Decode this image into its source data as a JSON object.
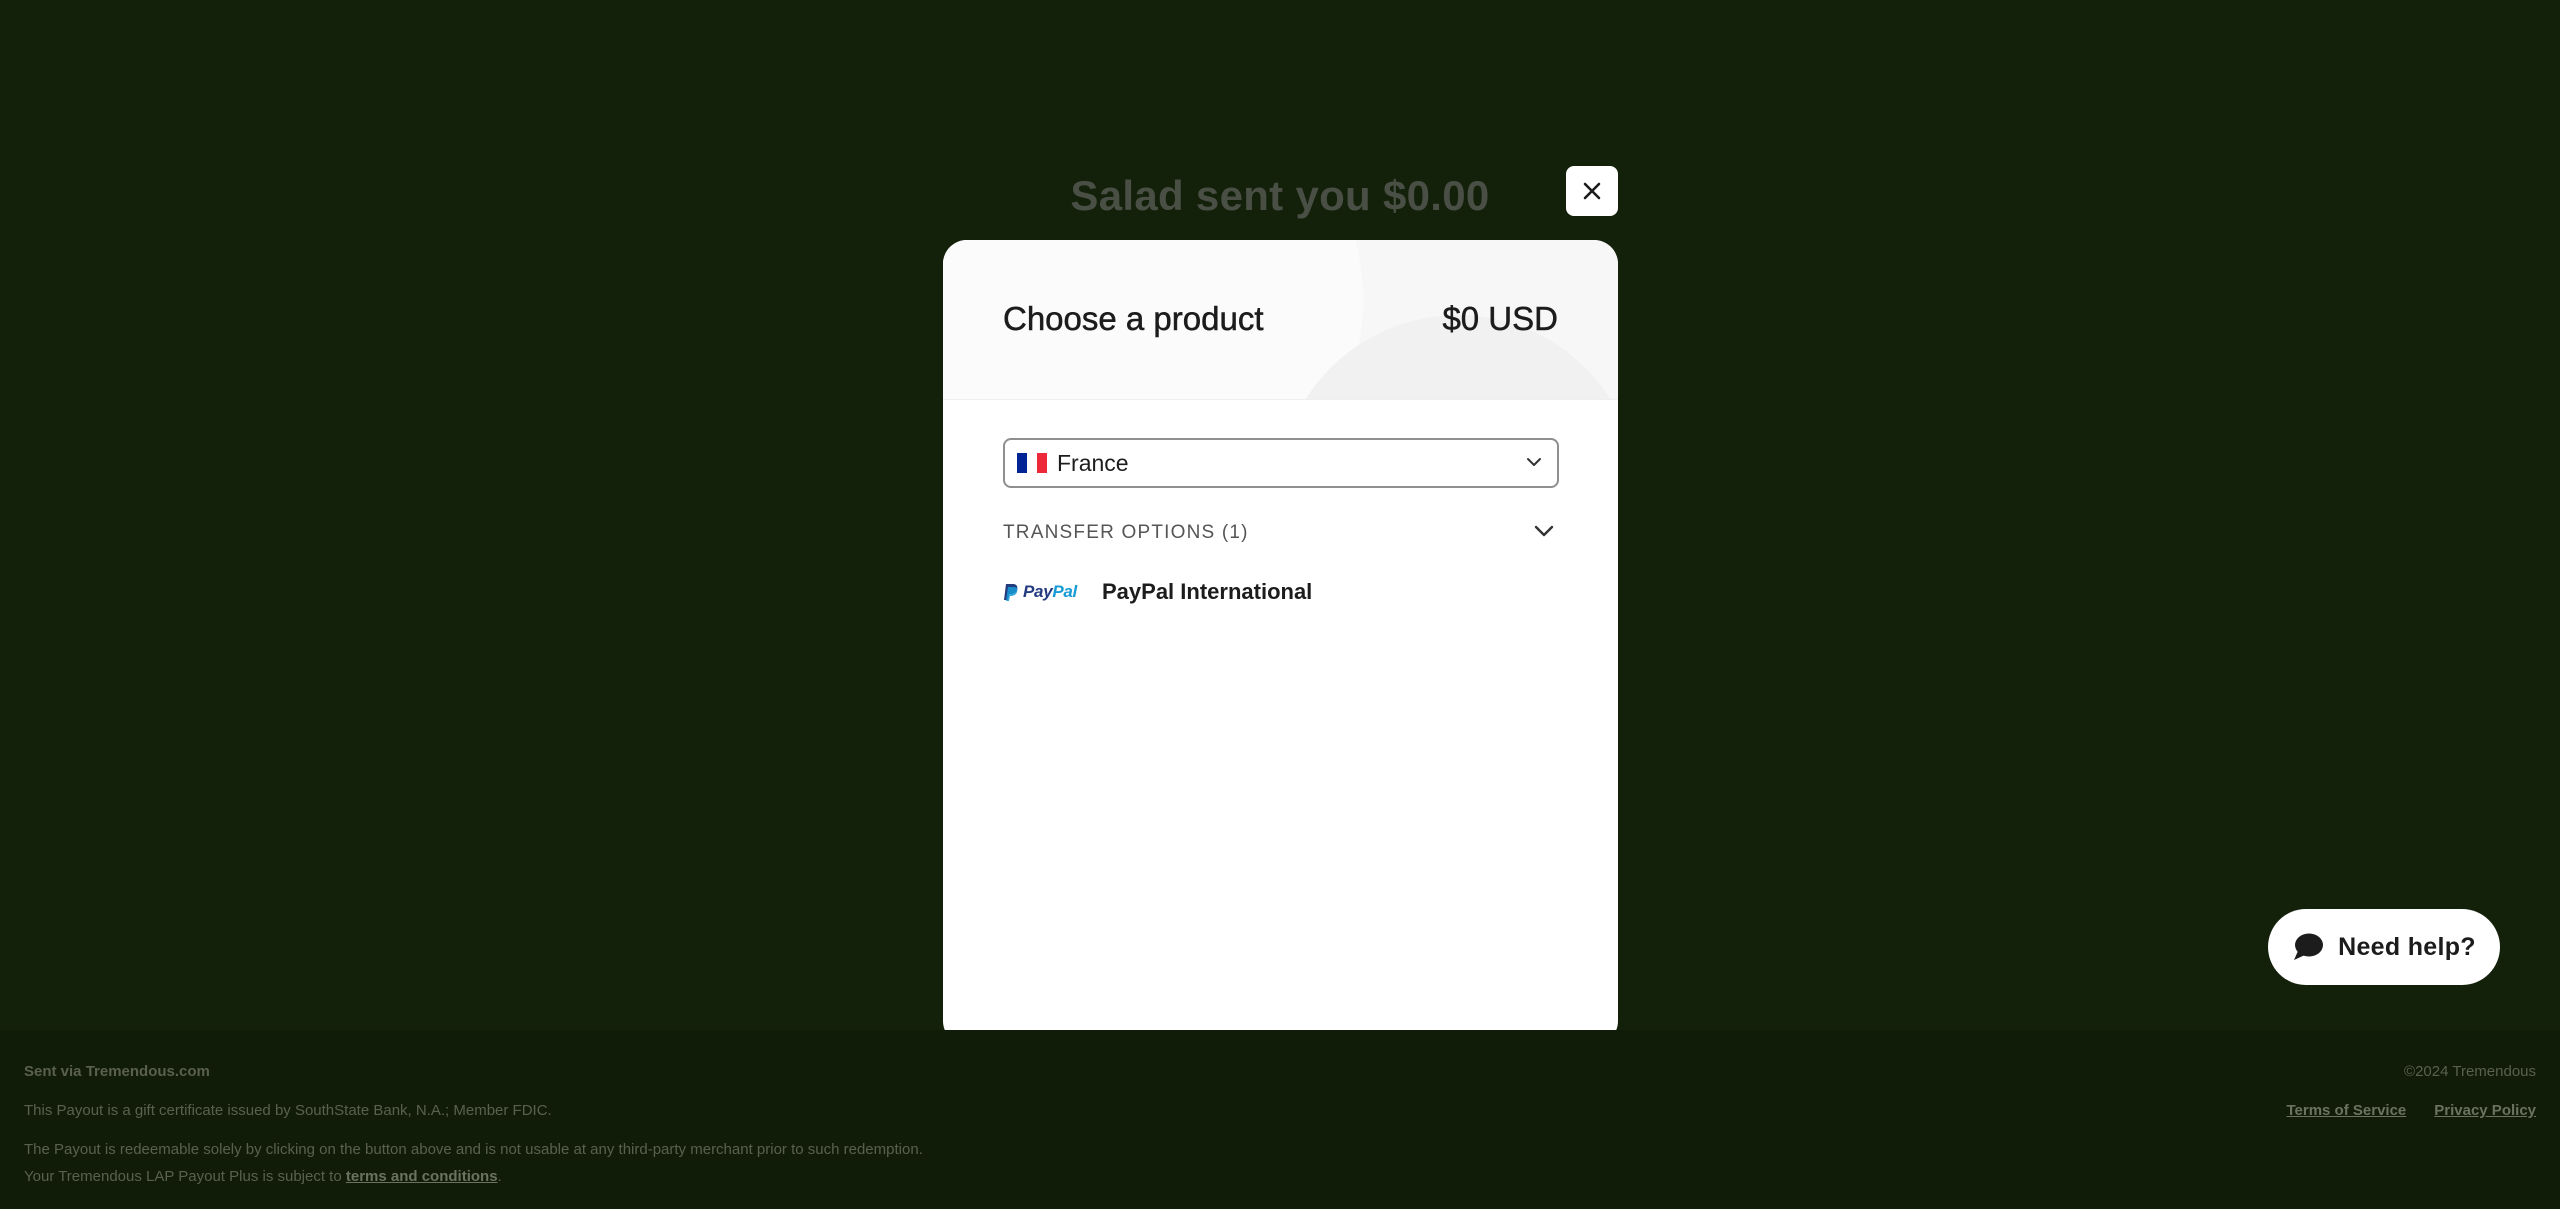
{
  "background": {
    "title": "Salad sent you $0.00"
  },
  "modal": {
    "title": "Choose a product",
    "amount": "$0 USD",
    "country_select": {
      "value": "France",
      "flag_colors": [
        "#002395",
        "#ffffff",
        "#ed2939"
      ]
    },
    "transfer_options": {
      "label": "TRANSFER OPTIONS (1)"
    },
    "products": [
      {
        "logo_text_a": "Pay",
        "logo_text_b": "Pal",
        "name": "PayPal International"
      }
    ]
  },
  "help": {
    "label": "Need help?"
  },
  "footer": {
    "sent_via": "Sent via Tremendous.com",
    "line1": "This Payout is a gift certificate issued by SouthState Bank, N.A.; Member FDIC.",
    "line2": "The Payout is redeemable solely by clicking on the button above and is not usable at any third-party merchant prior to such redemption.",
    "line3_prefix": "Your Tremendous LAP Payout Plus is subject to ",
    "line3_link": "terms and conditions",
    "line3_suffix": ".",
    "copyright": "©2024 Tremendous",
    "terms_link": "Terms of Service",
    "privacy_link": "Privacy Policy"
  },
  "colors": {
    "page_background": "#14210a",
    "paypal_dark": "#253b80",
    "paypal_light": "#179bd7"
  }
}
